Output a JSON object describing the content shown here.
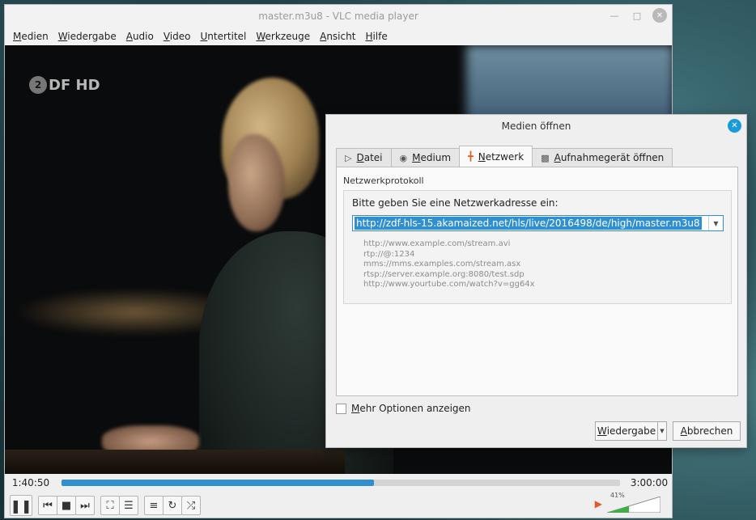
{
  "window": {
    "title": "master.m3u8 - VLC media player"
  },
  "menu": [
    {
      "key": "M",
      "rest": "edien"
    },
    {
      "key": "W",
      "rest": "iedergabe"
    },
    {
      "key": "A",
      "rest": "udio"
    },
    {
      "key": "V",
      "rest": "ideo"
    },
    {
      "key": "U",
      "rest": "ntertitel"
    },
    {
      "key": "W",
      "rest": "erkzeuge"
    },
    {
      "key": "A",
      "rest": "nsicht"
    },
    {
      "key": "H",
      "rest": "ilfe"
    }
  ],
  "video": {
    "channel_logo": "ZDF HD",
    "channel_logo_ring": "2",
    "channel_logo_text": "DF HD"
  },
  "player": {
    "elapsed": "1:40:50",
    "total": "3:00:00",
    "progress_fraction": 0.56,
    "volume_percent": "41%",
    "volume_fraction": 0.41,
    "accent_color": "#2f8fd0"
  },
  "icons": {
    "pause": "pause-icon",
    "previous": "previous-icon",
    "stop": "stop-icon",
    "next": "next-icon",
    "fullscreen": "fullscreen-icon",
    "extended": "equalizer-icon",
    "playlist": "playlist-icon",
    "loop": "loop-icon",
    "random": "shuffle-icon",
    "speaker": "speaker-icon"
  },
  "dialog": {
    "title": "Medien öffnen",
    "tabs": [
      {
        "pre": "",
        "key": "D",
        "rest": "atei"
      },
      {
        "pre": "",
        "key": "M",
        "rest": "edium"
      },
      {
        "pre": "",
        "key": "N",
        "rest": "etzwerk"
      },
      {
        "pre": "",
        "key": "A",
        "rest": "ufnahmegerät öffnen"
      }
    ],
    "active_tab": "Netzwerk",
    "group_label": "Netzwerkprotokoll",
    "prompt": "Bitte geben Sie eine Netzwerkadresse ein:",
    "url_value": "http://zdf-hls-15.akamaized.net/hls/live/2016498/de/high/master.m3u8",
    "examples": [
      "http://www.example.com/stream.avi",
      "rtp://@:1234",
      "mms://mms.examples.com/stream.asx",
      "rtsp://server.example.org:8080/test.sdp",
      "http://www.yourtube.com/watch?v=gg64x"
    ],
    "more_options": {
      "key": "M",
      "rest": "ehr Optionen anzeigen"
    },
    "play_button": {
      "key": "W",
      "rest": "iedergabe"
    },
    "cancel_button": {
      "key": "A",
      "rest": "bbrechen"
    }
  }
}
